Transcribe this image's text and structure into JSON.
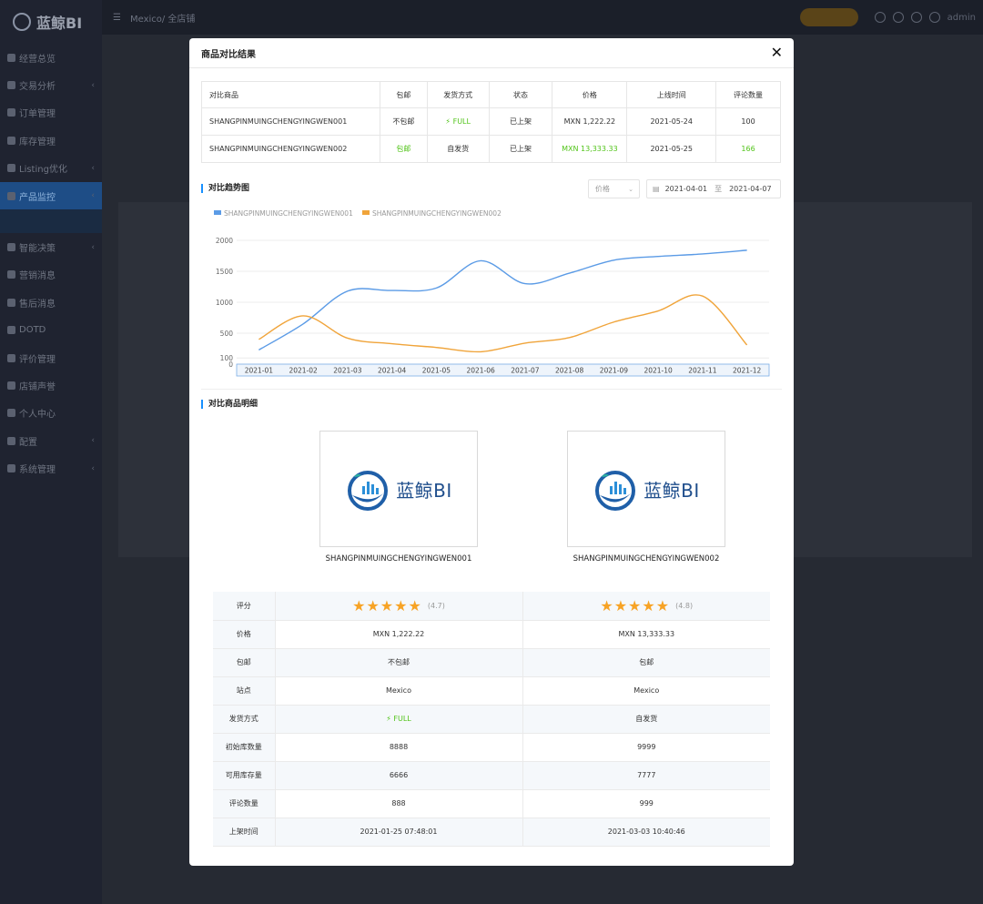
{
  "app": {
    "brand": "蓝鲸BI"
  },
  "topbar": {
    "store": "Mexico/ 全店铺",
    "upgrade": "",
    "lang": "",
    "user": "admin"
  },
  "sidebar": {
    "items": [
      {
        "label": "经营总览"
      },
      {
        "label": "交易分析"
      },
      {
        "label": "订单管理"
      },
      {
        "label": "库存管理"
      },
      {
        "label": "Listing优化"
      },
      {
        "label": "产品监控"
      },
      {
        "label": "智能决策"
      },
      {
        "label": "营销消息"
      },
      {
        "label": "售后消息"
      },
      {
        "label": "DOTD"
      },
      {
        "label": "评价管理"
      },
      {
        "label": "店铺声誉"
      },
      {
        "label": "个人中心"
      },
      {
        "label": "配置"
      },
      {
        "label": "系统管理"
      }
    ]
  },
  "modal": {
    "title": "商品对比结果",
    "close": "✕",
    "compare": {
      "headers": [
        "对比商品",
        "包邮",
        "发货方式",
        "状态",
        "价格",
        "上线时间",
        "评论数量"
      ],
      "rows": [
        {
          "name": "SHANGPINMUINGCHENGYINGWEN001",
          "free": "不包邮",
          "ship": "FULL",
          "status": "已上架",
          "price": "MXN 1,222.22",
          "date": "2021-05-24",
          "reviews": "100"
        },
        {
          "name": "SHANGPINMUINGCHENGYINGWEN002",
          "free": "包邮",
          "ship": "自发货",
          "status": "已上架",
          "price": "MXN 13,333.33",
          "date": "2021-05-25",
          "reviews": "166"
        }
      ]
    },
    "trend": {
      "title": "对比趋势图",
      "metric": "价格",
      "date_from": "2021-04-01",
      "date_sep": "至",
      "date_to": "2021-04-07"
    },
    "detail": {
      "title": "对比商品明细",
      "products": [
        {
          "logo_text": "蓝鲸BI",
          "name": "SHANGPINMUINGCHENGYINGWEN001"
        },
        {
          "logo_text": "蓝鲸BI",
          "name": "SHANGPINMUINGCHENGYINGWEN002"
        }
      ],
      "rows": [
        {
          "label": "评分",
          "v1": "(4.7)",
          "v2": "(4.8)"
        },
        {
          "label": "价格",
          "v1": "MXN 1,222.22",
          "v2": "MXN 13,333.33"
        },
        {
          "label": "包邮",
          "v1": "不包邮",
          "v2": "包邮"
        },
        {
          "label": "站点",
          "v1": "Mexico",
          "v2": "Mexico"
        },
        {
          "label": "发货方式",
          "v1": "FULL",
          "v2": "自发货"
        },
        {
          "label": "初始库数量",
          "v1": "8888",
          "v2": "9999"
        },
        {
          "label": "可用库存量",
          "v1": "6666",
          "v2": "7777"
        },
        {
          "label": "评论数量",
          "v1": "888",
          "v2": "999"
        },
        {
          "label": "上架时间",
          "v1": "2021-01-25 07:48:01",
          "v2": "2021-03-03 10:40:46"
        }
      ]
    }
  },
  "chart_data": {
    "type": "line",
    "categories": [
      "2021-01",
      "2021-02",
      "2021-03",
      "2021-04",
      "2021-05",
      "2021-06",
      "2021-07",
      "2021-08",
      "2021-09",
      "2021-10",
      "2021-11",
      "2021-12"
    ],
    "series": [
      {
        "name": "SHANGPINMUINGCHENGYINGWEN001",
        "color": "#5b9be6",
        "values": [
          230,
          650,
          1180,
          1190,
          1230,
          1670,
          1300,
          1470,
          1680,
          1740,
          1780,
          1840
        ]
      },
      {
        "name": "SHANGPINMUINGCHENGYINGWEN002",
        "color": "#f0a43a",
        "values": [
          400,
          780,
          420,
          330,
          270,
          200,
          340,
          430,
          680,
          860,
          1100,
          310
        ]
      }
    ],
    "yticks": [
      0,
      100,
      500,
      1000,
      1500,
      2000
    ],
    "ylim": [
      0,
      2000
    ],
    "grid": true,
    "legend": "top-left"
  }
}
